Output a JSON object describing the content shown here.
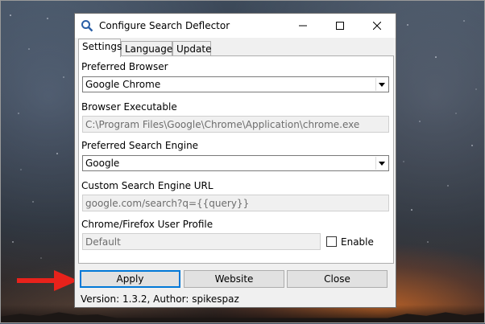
{
  "window": {
    "title": "Configure Search Deflector"
  },
  "tabs": [
    {
      "label": "Settings",
      "active": true
    },
    {
      "label": "Language",
      "active": false
    },
    {
      "label": "Update",
      "active": false
    }
  ],
  "settings": {
    "preferred_browser": {
      "label": "Preferred Browser",
      "value": "Google Chrome"
    },
    "browser_executable": {
      "label": "Browser Executable",
      "value": "C:\\Program Files\\Google\\Chrome\\Application\\chrome.exe"
    },
    "preferred_search_engine": {
      "label": "Preferred Search Engine",
      "value": "Google"
    },
    "custom_search_engine_url": {
      "label": "Custom Search Engine URL",
      "value": "google.com/search?q={{query}}"
    },
    "user_profile": {
      "label": "Chrome/Firefox User Profile",
      "value": "Default",
      "enable_label": "Enable",
      "enabled": false
    }
  },
  "buttons": {
    "apply": "Apply",
    "website": "Website",
    "close": "Close"
  },
  "status": "Version: 1.3.2, Author: spikespaz",
  "colors": {
    "annotation_arrow": "#e8221b",
    "focus_border": "#0078d7"
  }
}
